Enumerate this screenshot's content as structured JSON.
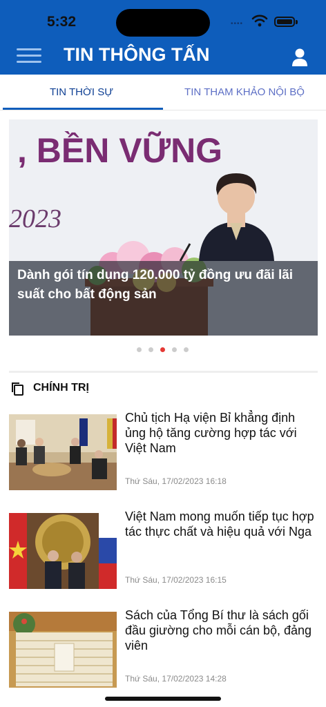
{
  "status_bar": {
    "time": "5:32"
  },
  "header": {
    "title": "TIN THÔNG TẤN",
    "menu_icon": "hamburger-icon",
    "user_icon": "user-icon",
    "bg_color": "#0e5dbb"
  },
  "tabs": [
    {
      "label": "TIN THỜI SỰ",
      "active": true
    },
    {
      "label": "TIN THAM KHẢO NỘI BỘ",
      "active": false
    }
  ],
  "carousel": {
    "backdrop_text": ", BỀN VỮNG",
    "backdrop_year": "2023",
    "caption": "Dành gói tín dụng 120.000 tỷ đồng ưu đãi lãi suất cho bất động sản",
    "dot_count": 5,
    "active_index": 2,
    "active_dot_color": "#e53935"
  },
  "section": {
    "title": "CHÍNH TRỊ",
    "icon": "copy-icon"
  },
  "articles": [
    {
      "title": "Chủ tịch Hạ viện Bỉ khẳng định ủng hộ tăng cường hợp tác với Việt Nam",
      "date": "Thứ Sáu, 17/02/2023 16:18"
    },
    {
      "title": "Việt Nam mong muốn tiếp tục hợp tác thực chất và hiệu quả với Nga",
      "date": "Thứ Sáu, 17/02/2023 16:15"
    },
    {
      "title": "Sách của Tổng Bí thư là sách gối đầu giường cho mỗi cán bộ, đảng viên",
      "date": "Thứ Sáu, 17/02/2023 14:28"
    }
  ]
}
